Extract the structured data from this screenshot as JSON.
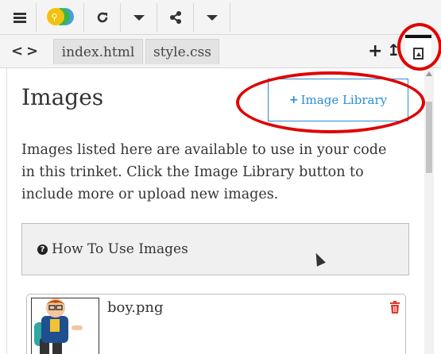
{
  "toolbar": {
    "menu_icon": "hamburger-icon",
    "logo_icon": "trinket-logo",
    "reload_icon": "reload-icon",
    "share_icon": "share-icon",
    "caret_icon": "caret-down-icon"
  },
  "tabs": {
    "items": [
      {
        "label": "index.html"
      },
      {
        "label": "style.css"
      }
    ],
    "add_icon": "plus-icon",
    "upload_icon": "upload-icon",
    "images_tab_icon": "image-icon"
  },
  "images_panel": {
    "title": "Images",
    "library_button": "Image Library",
    "description": "Images listed here are available to use in your code in this trinket. Click the Image Library button to include more or upload new images.",
    "how_to": "How To Use Images",
    "images": [
      {
        "name": "boy.png"
      }
    ]
  },
  "colors": {
    "accent": "#2a8fd4",
    "annotation": "#e00000",
    "delete": "#e03a2a"
  }
}
